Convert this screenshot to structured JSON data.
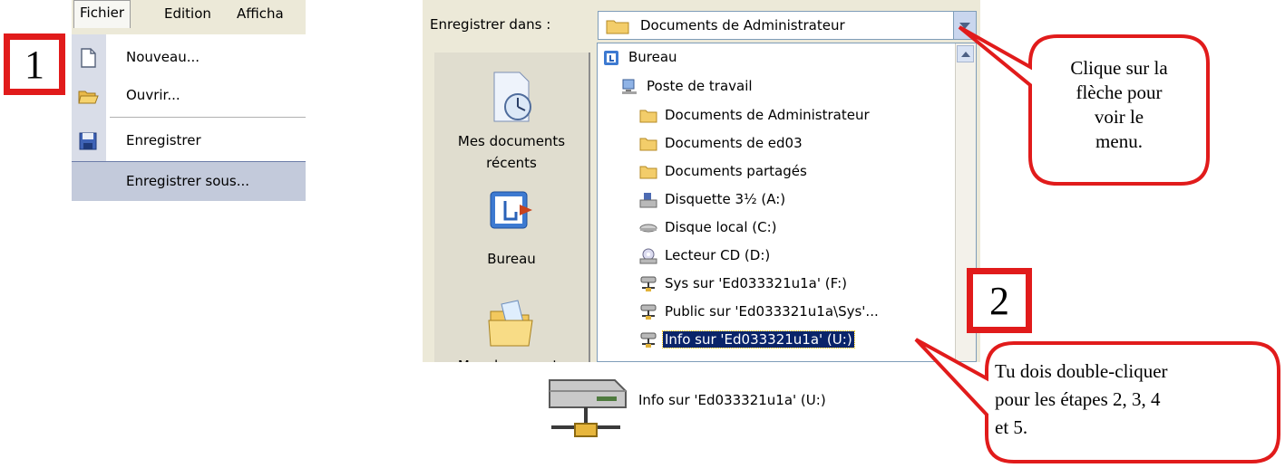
{
  "steps": {
    "step1": "1",
    "step2": "2"
  },
  "menu": {
    "bar": {
      "fichier": "Fichier",
      "edition": "Edition",
      "affichage": "Afficha"
    },
    "items": [
      {
        "label": "Nouveau...",
        "icon": "new-document-icon"
      },
      {
        "label": "Ouvrir...",
        "icon": "open-folder-icon"
      },
      {
        "label": "Enregistrer",
        "icon": "floppy-save-icon"
      },
      {
        "label": "Enregistrer sous..."
      }
    ]
  },
  "dialog": {
    "save_in_label": "Enregistrer dans :",
    "combo_value": "Documents de Administrateur",
    "places": [
      {
        "label_line1": "Mes documents",
        "label_line2": "récents",
        "icon": "recent-documents-icon"
      },
      {
        "label_line1": "Bureau",
        "icon": "desktop-icon"
      },
      {
        "label_line1": "Mes documents",
        "icon": "my-documents-icon"
      }
    ],
    "list": [
      {
        "label": "Bureau",
        "icon": "desktop-icon"
      },
      {
        "label": "Poste de travail",
        "icon": "computer-icon"
      },
      {
        "label": "Documents de Administrateur",
        "icon": "folder-icon"
      },
      {
        "label": "Documents de ed03",
        "icon": "folder-icon"
      },
      {
        "label": "Documents partagés",
        "icon": "folder-icon"
      },
      {
        "label": "Disquette 3½ (A:)",
        "icon": "floppy-drive-icon"
      },
      {
        "label": "Disque local (C:)",
        "icon": "hard-disk-icon"
      },
      {
        "label": "Lecteur CD (D:)",
        "icon": "cd-drive-icon"
      },
      {
        "label": "Sys sur 'Ed033321u1a' (F:)",
        "icon": "network-drive-icon"
      },
      {
        "label": "Public sur 'Ed033321u1a\\Sys'...",
        "icon": "network-drive-icon"
      },
      {
        "label": "Info sur 'Ed033321u1a' (U:)",
        "icon": "network-drive-icon",
        "selected": true
      }
    ]
  },
  "drive_below": {
    "label": "Info sur 'Ed033321u1a' (U:)",
    "icon": "network-drive-icon"
  },
  "callouts": {
    "arrow_tip": [
      "Clique sur la",
      "flèche pour",
      "voir le",
      "menu."
    ],
    "double_click": [
      "Tu dois double-cliquer",
      "pour les étapes 2, 3, 4",
      "et 5."
    ]
  },
  "colors": {
    "highlight_red": "#e11b1b",
    "selection_blue": "#0a246a",
    "dialog_bg": "#ece9d8"
  }
}
